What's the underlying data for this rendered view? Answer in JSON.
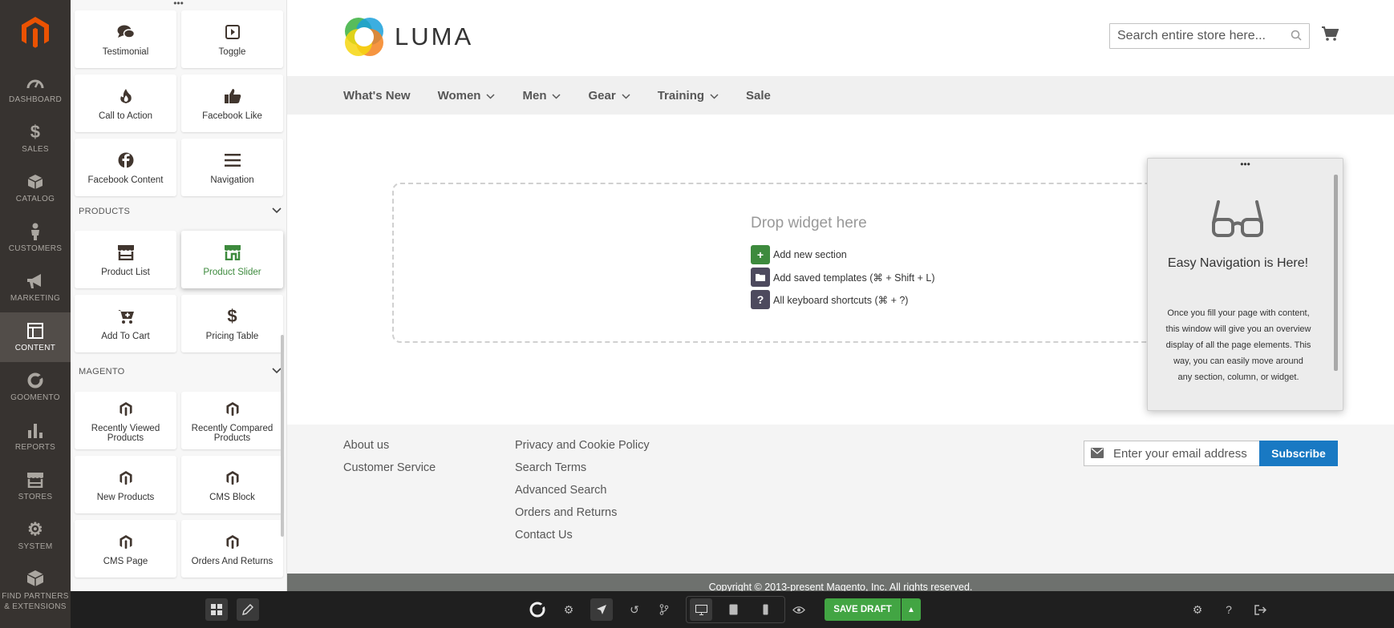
{
  "admin_nav": {
    "items": [
      {
        "label": "DASHBOARD",
        "icon": "dashboard-icon"
      },
      {
        "label": "SALES",
        "icon": "dollar-icon"
      },
      {
        "label": "CATALOG",
        "icon": "cube-icon"
      },
      {
        "label": "CUSTOMERS",
        "icon": "person-icon"
      },
      {
        "label": "MARKETING",
        "icon": "megaphone-icon"
      },
      {
        "label": "CONTENT",
        "icon": "layout-icon"
      },
      {
        "label": "GOOMENTO",
        "icon": "goomento-icon"
      },
      {
        "label": "REPORTS",
        "icon": "bar-chart-icon"
      },
      {
        "label": "STORES",
        "icon": "store-icon"
      },
      {
        "label": "SYSTEM",
        "icon": "gear-icon"
      },
      {
        "label": "FIND PARTNERS & EXTENSIONS",
        "icon": "blocks-icon"
      }
    ],
    "active": "CONTENT"
  },
  "panel": {
    "widgets_top": [
      {
        "label": "Testimonial",
        "icon": "chat-icon"
      },
      {
        "label": "Toggle",
        "icon": "toggle-icon"
      },
      {
        "label": "Call to Action",
        "icon": "fire-icon"
      },
      {
        "label": "Facebook Like",
        "icon": "thumbs-up-icon"
      },
      {
        "label": "Facebook Content",
        "icon": "facebook-icon"
      },
      {
        "label": "Navigation",
        "icon": "hamburger-icon"
      }
    ],
    "products_header": "PRODUCTS",
    "products": [
      {
        "label": "Product List",
        "icon": "store-icon"
      },
      {
        "label": "Product Slider",
        "icon": "store-slider-icon"
      },
      {
        "label": "Add To Cart",
        "icon": "cart-plus-icon"
      },
      {
        "label": "Pricing Table",
        "icon": "dollar-icon"
      }
    ],
    "magento_header": "MAGENTO",
    "magento": [
      {
        "label": "Recently Viewed Products",
        "icon": "magento-icon"
      },
      {
        "label": "Recently Compared Products",
        "icon": "magento-icon"
      },
      {
        "label": "New Products",
        "icon": "magento-icon"
      },
      {
        "label": "CMS Block",
        "icon": "magento-icon"
      },
      {
        "label": "CMS Page",
        "icon": "magento-icon"
      },
      {
        "label": "Orders And Returns",
        "icon": "magento-icon"
      }
    ]
  },
  "store": {
    "logo_text": "LUMA",
    "search_placeholder": "Search entire store here...",
    "nav": [
      "What's New",
      "Women",
      "Men",
      "Gear",
      "Training",
      "Sale"
    ],
    "nav_dropdowns": [
      false,
      true,
      true,
      true,
      true,
      false
    ],
    "drop_title": "Drop widget here",
    "add_section": "Add new section",
    "add_templates": "Add saved templates (⌘ + Shift + L)",
    "shortcuts": "All keyboard shortcuts (⌘ + ?)",
    "footer_col1": [
      "About us",
      "Customer Service"
    ],
    "footer_col2": [
      "Privacy and Cookie Policy",
      "Search Terms",
      "Advanced Search",
      "Orders and Returns",
      "Contact Us"
    ],
    "newsletter_placeholder": "Enter your email address",
    "subscribe_label": "Subscribe",
    "copyright": "Copyright © 2013-present Magento, Inc. All rights reserved."
  },
  "easy_nav": {
    "title": "Easy Navigation is Here!",
    "body": "Once you fill your page with content, this window will give you an overview display of all the page elements. This way, you can easily move around any section, column, or widget."
  },
  "toolbar": {
    "save_label": "SAVE DRAFT"
  },
  "colors": {
    "admin_nav_bg": "#373330",
    "brand_orange": "#eb5202",
    "save_green": "#42a543",
    "subscribe_blue": "#1979c3",
    "highlight_green": "#3d8a3d"
  }
}
